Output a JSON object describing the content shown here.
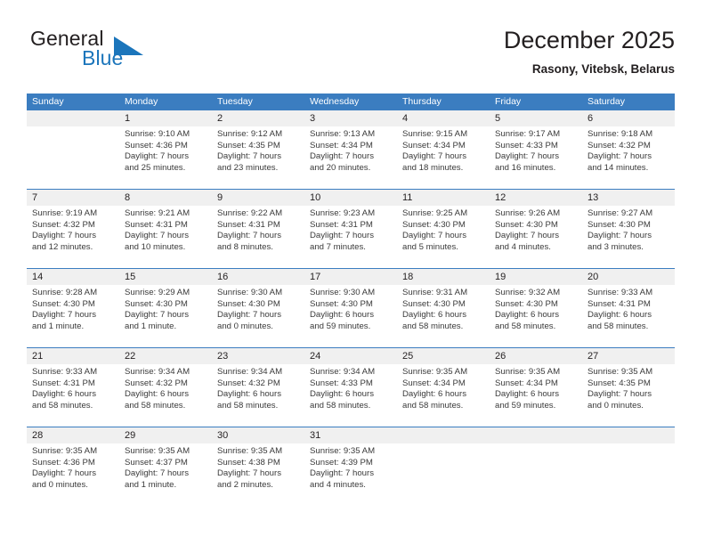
{
  "brand": {
    "word_general": "General",
    "word_blue": "Blue",
    "triangle_color": "#1b75bb"
  },
  "header": {
    "title": "December 2025",
    "subtitle": "Rasony, Vitebsk, Belarus"
  },
  "theme": {
    "header_blue": "#3b7dc0",
    "daynum_band": "#f0f0f0",
    "text": "#231f20"
  },
  "weekday_headers": [
    "Sunday",
    "Monday",
    "Tuesday",
    "Wednesday",
    "Thursday",
    "Friday",
    "Saturday"
  ],
  "weeks": [
    [
      {
        "day": "",
        "lines": [
          "",
          "",
          "",
          ""
        ]
      },
      {
        "day": "1",
        "lines": [
          "Sunrise: 9:10 AM",
          "Sunset: 4:36 PM",
          "Daylight: 7 hours",
          "and 25 minutes."
        ]
      },
      {
        "day": "2",
        "lines": [
          "Sunrise: 9:12 AM",
          "Sunset: 4:35 PM",
          "Daylight: 7 hours",
          "and 23 minutes."
        ]
      },
      {
        "day": "3",
        "lines": [
          "Sunrise: 9:13 AM",
          "Sunset: 4:34 PM",
          "Daylight: 7 hours",
          "and 20 minutes."
        ]
      },
      {
        "day": "4",
        "lines": [
          "Sunrise: 9:15 AM",
          "Sunset: 4:34 PM",
          "Daylight: 7 hours",
          "and 18 minutes."
        ]
      },
      {
        "day": "5",
        "lines": [
          "Sunrise: 9:17 AM",
          "Sunset: 4:33 PM",
          "Daylight: 7 hours",
          "and 16 minutes."
        ]
      },
      {
        "day": "6",
        "lines": [
          "Sunrise: 9:18 AM",
          "Sunset: 4:32 PM",
          "Daylight: 7 hours",
          "and 14 minutes."
        ]
      }
    ],
    [
      {
        "day": "7",
        "lines": [
          "Sunrise: 9:19 AM",
          "Sunset: 4:32 PM",
          "Daylight: 7 hours",
          "and 12 minutes."
        ]
      },
      {
        "day": "8",
        "lines": [
          "Sunrise: 9:21 AM",
          "Sunset: 4:31 PM",
          "Daylight: 7 hours",
          "and 10 minutes."
        ]
      },
      {
        "day": "9",
        "lines": [
          "Sunrise: 9:22 AM",
          "Sunset: 4:31 PM",
          "Daylight: 7 hours",
          "and 8 minutes."
        ]
      },
      {
        "day": "10",
        "lines": [
          "Sunrise: 9:23 AM",
          "Sunset: 4:31 PM",
          "Daylight: 7 hours",
          "and 7 minutes."
        ]
      },
      {
        "day": "11",
        "lines": [
          "Sunrise: 9:25 AM",
          "Sunset: 4:30 PM",
          "Daylight: 7 hours",
          "and 5 minutes."
        ]
      },
      {
        "day": "12",
        "lines": [
          "Sunrise: 9:26 AM",
          "Sunset: 4:30 PM",
          "Daylight: 7 hours",
          "and 4 minutes."
        ]
      },
      {
        "day": "13",
        "lines": [
          "Sunrise: 9:27 AM",
          "Sunset: 4:30 PM",
          "Daylight: 7 hours",
          "and 3 minutes."
        ]
      }
    ],
    [
      {
        "day": "14",
        "lines": [
          "Sunrise: 9:28 AM",
          "Sunset: 4:30 PM",
          "Daylight: 7 hours",
          "and 1 minute."
        ]
      },
      {
        "day": "15",
        "lines": [
          "Sunrise: 9:29 AM",
          "Sunset: 4:30 PM",
          "Daylight: 7 hours",
          "and 1 minute."
        ]
      },
      {
        "day": "16",
        "lines": [
          "Sunrise: 9:30 AM",
          "Sunset: 4:30 PM",
          "Daylight: 7 hours",
          "and 0 minutes."
        ]
      },
      {
        "day": "17",
        "lines": [
          "Sunrise: 9:30 AM",
          "Sunset: 4:30 PM",
          "Daylight: 6 hours",
          "and 59 minutes."
        ]
      },
      {
        "day": "18",
        "lines": [
          "Sunrise: 9:31 AM",
          "Sunset: 4:30 PM",
          "Daylight: 6 hours",
          "and 58 minutes."
        ]
      },
      {
        "day": "19",
        "lines": [
          "Sunrise: 9:32 AM",
          "Sunset: 4:30 PM",
          "Daylight: 6 hours",
          "and 58 minutes."
        ]
      },
      {
        "day": "20",
        "lines": [
          "Sunrise: 9:33 AM",
          "Sunset: 4:31 PM",
          "Daylight: 6 hours",
          "and 58 minutes."
        ]
      }
    ],
    [
      {
        "day": "21",
        "lines": [
          "Sunrise: 9:33 AM",
          "Sunset: 4:31 PM",
          "Daylight: 6 hours",
          "and 58 minutes."
        ]
      },
      {
        "day": "22",
        "lines": [
          "Sunrise: 9:34 AM",
          "Sunset: 4:32 PM",
          "Daylight: 6 hours",
          "and 58 minutes."
        ]
      },
      {
        "day": "23",
        "lines": [
          "Sunrise: 9:34 AM",
          "Sunset: 4:32 PM",
          "Daylight: 6 hours",
          "and 58 minutes."
        ]
      },
      {
        "day": "24",
        "lines": [
          "Sunrise: 9:34 AM",
          "Sunset: 4:33 PM",
          "Daylight: 6 hours",
          "and 58 minutes."
        ]
      },
      {
        "day": "25",
        "lines": [
          "Sunrise: 9:35 AM",
          "Sunset: 4:34 PM",
          "Daylight: 6 hours",
          "and 58 minutes."
        ]
      },
      {
        "day": "26",
        "lines": [
          "Sunrise: 9:35 AM",
          "Sunset: 4:34 PM",
          "Daylight: 6 hours",
          "and 59 minutes."
        ]
      },
      {
        "day": "27",
        "lines": [
          "Sunrise: 9:35 AM",
          "Sunset: 4:35 PM",
          "Daylight: 7 hours",
          "and 0 minutes."
        ]
      }
    ],
    [
      {
        "day": "28",
        "lines": [
          "Sunrise: 9:35 AM",
          "Sunset: 4:36 PM",
          "Daylight: 7 hours",
          "and 0 minutes."
        ]
      },
      {
        "day": "29",
        "lines": [
          "Sunrise: 9:35 AM",
          "Sunset: 4:37 PM",
          "Daylight: 7 hours",
          "and 1 minute."
        ]
      },
      {
        "day": "30",
        "lines": [
          "Sunrise: 9:35 AM",
          "Sunset: 4:38 PM",
          "Daylight: 7 hours",
          "and 2 minutes."
        ]
      },
      {
        "day": "31",
        "lines": [
          "Sunrise: 9:35 AM",
          "Sunset: 4:39 PM",
          "Daylight: 7 hours",
          "and 4 minutes."
        ]
      },
      {
        "day": "",
        "lines": [
          "",
          "",
          "",
          ""
        ]
      },
      {
        "day": "",
        "lines": [
          "",
          "",
          "",
          ""
        ]
      },
      {
        "day": "",
        "lines": [
          "",
          "",
          "",
          ""
        ]
      }
    ]
  ]
}
